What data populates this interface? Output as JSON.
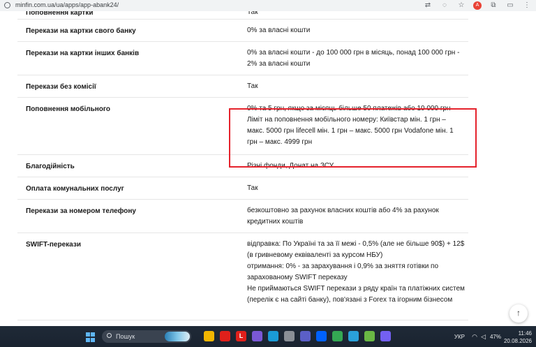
{
  "browser": {
    "url": "minfin.com.ua/ua/apps/app-abank24/",
    "icons": [
      "tune-icon",
      "translate-icon",
      "eye-off-icon",
      "star-icon",
      "account-icon",
      "extensions-icon",
      "sidebar-icon",
      "menu-icon"
    ],
    "avatar_letter": "A"
  },
  "table": {
    "rows": [
      {
        "label": "Поповнення картки",
        "value": [
          "Так"
        ]
      },
      {
        "label": "Перекази на картки свого банку",
        "value": [
          "0% за власні кошти"
        ]
      },
      {
        "label": "Перекази на картки інших банків",
        "value": [
          "0% за власні кошти - до 100 000 грн в місяць, понад 100 000 грн -",
          "2% за власні кошти"
        ]
      },
      {
        "label": "Перекази без комісії",
        "value": [
          "Так"
        ]
      },
      {
        "label": "Поповнення мобільного",
        "value": [
          "0% та 5 грн, якщо за місяць більше 50 платежів або 10 000 грн",
          "Ліміт на поповнення мобільного номеру: Київстар мін. 1 грн –",
          "макс. 5000 грн lifecell мін. 1 грн – макс. 5000 грн Vodafone мін. 1",
          "грн – макс. 4999 грн"
        ]
      },
      {
        "label": "Благодійність",
        "value": [
          "Різні фонди, Донат на ЗСУ"
        ]
      },
      {
        "label": "Оплата комунальних послуг",
        "value": [
          "Так"
        ]
      },
      {
        "label": "Перекази за номером телефону",
        "value": [
          "безкоштовно за рахунок власних коштів або 4% за рахунок",
          "кредитних коштів"
        ]
      },
      {
        "label": "SWIFT-перекази",
        "value": [
          "відправка: По Україні та за її межі - 0,5% (але не більше 90$) + 12$",
          "(в гривневому еквіваленті за курсом НБУ)",
          "отримання: 0% - за зарахування і 0,9% за зняття готівки по",
          "зарахованому SWIFT переказу",
          "Не приймаються SWIFT перекази з ряду країн та платіжних систем",
          "(перелік є на сайті банку), пов'язані з Forex та ігорним бізнесом"
        ]
      }
    ]
  },
  "scroll_top": "↑",
  "taskbar": {
    "search_placeholder": "Пошук",
    "apps": [
      {
        "name": "file-explorer-icon",
        "color": "#f2b600"
      },
      {
        "name": "opera-icon",
        "color": "#e0201b"
      },
      {
        "name": "l-app-icon",
        "color": "#e0201b",
        "letter": "L"
      },
      {
        "name": "photos-icon",
        "color": "#7a58d6"
      },
      {
        "name": "edge-icon",
        "color": "#1a9bd6"
      },
      {
        "name": "settings-icon",
        "color": "#8a8f96"
      },
      {
        "name": "teams-icon",
        "color": "#5b5fc7"
      },
      {
        "name": "dropbox-icon",
        "color": "#0061fe"
      },
      {
        "name": "chrome-icon",
        "color": "#34a853"
      },
      {
        "name": "telegram-icon",
        "color": "#2aa1da"
      },
      {
        "name": "utorrent-icon",
        "color": "#6ab744"
      },
      {
        "name": "viber-icon",
        "color": "#7360f2"
      }
    ],
    "lang": "УКР",
    "battery": "47%",
    "time": "11:46",
    "date": "20.08.2026"
  },
  "colors": {
    "highlight": "#e5222c",
    "taskbar": "#1f2a37"
  }
}
